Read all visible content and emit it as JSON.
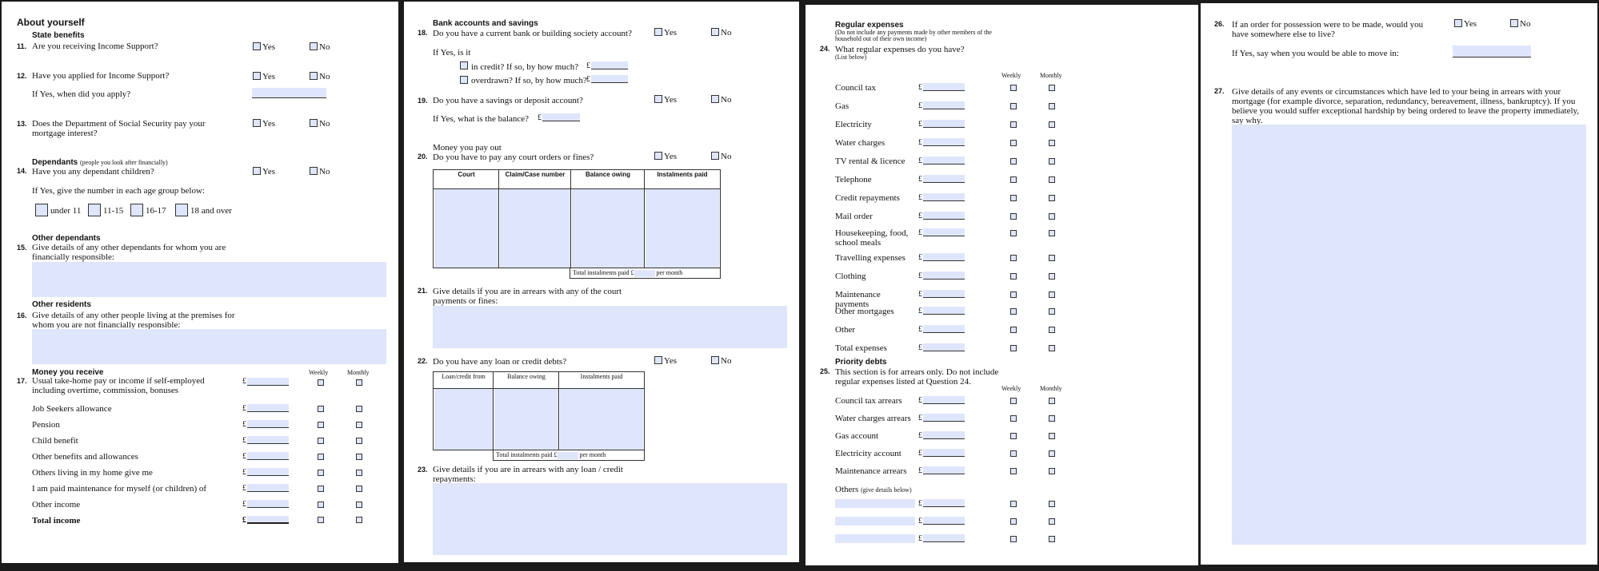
{
  "p1": {
    "section_title": "About yourself",
    "state_benefits": "State benefits",
    "q11": {
      "num": "11.",
      "text": "Are you receiving Income Support?"
    },
    "q12": {
      "num": "12.",
      "text": "Have you applied for Income Support?",
      "sub": "If Yes, when did you apply?"
    },
    "q13": {
      "num": "13.",
      "text": "Does the Department of Social Security pay your mortgage interest?"
    },
    "dependants": "Dependants",
    "dependants_note": "(people you look after financially)",
    "q14": {
      "num": "14.",
      "text": "Have you any dependant children?",
      "sub": "If Yes, give the number in each age group below:"
    },
    "age_groups": [
      "under 11",
      "11-15",
      "16-17",
      "18 and over"
    ],
    "other_dependants": "Other dependants",
    "q15": {
      "num": "15.",
      "text": "Give details of any other dependants for whom you are financially responsible:"
    },
    "other_residents": "Other residents",
    "q16": {
      "num": "16.",
      "text": "Give details of any other people living at the premises for whom you are not financially responsible:"
    },
    "money_receive": "Money you receive",
    "q17": {
      "num": "17.",
      "text": "Usual take-home pay or income if self-employed including overtime, commission, bonuses"
    },
    "income_rows": [
      "Job Seekers allowance",
      "Pension",
      "Child benefit",
      "Other benefits and allowances",
      "Others living in my home give me",
      "I am paid maintenance for myself (or children) of",
      "Other income"
    ],
    "total_income": "Total income"
  },
  "p2": {
    "bank_title": "Bank accounts and savings",
    "q18": {
      "num": "18.",
      "text": "Do you have a current bank or building society account?",
      "sub": "If Yes, is it",
      "credit": "in credit? If so, by how much?",
      "overdrawn": "overdrawn? If so, by how much?"
    },
    "q19": {
      "num": "19.",
      "text": "Do you have a savings or deposit account?",
      "sub": "If Yes, what is the balance?"
    },
    "money_out": "Money you pay out",
    "q20": {
      "num": "20.",
      "text": "Do you have to pay any court orders or fines?"
    },
    "court_table_headers": [
      "Court",
      "Claim/Case number",
      "Balance owing",
      "Instalments paid"
    ],
    "court_total": "Total instalments paid £",
    "per_month": "per month",
    "q21": {
      "num": "21.",
      "text": "Give details if you are in arrears with any of the court payments or fines:"
    },
    "q22": {
      "num": "22.",
      "text": "Do you have any loan or credit debts?"
    },
    "loan_table_headers": [
      "Loan/credit from",
      "Balance owing",
      "Instalments paid"
    ],
    "loan_total": "Total instalments paid £",
    "q23": {
      "num": "23.",
      "text": "Give details if you are in arrears with any loan / credit repayments:"
    }
  },
  "p3": {
    "regular_title": "Regular expenses",
    "regular_note": "(Do not include any payments made by other members of the household out of their own income)",
    "q24": {
      "num": "24.",
      "text": "What regular expenses do you have?",
      "note": "(List below)"
    },
    "expense_rows": [
      "Council tax",
      "Gas",
      "Electricity",
      "Water charges",
      "TV rental & licence",
      "Telephone",
      "Credit repayments",
      "Mail order",
      "Housekeeping, food, school meals",
      "Travelling expenses",
      "Clothing",
      "Maintenance payments",
      "Other mortgages",
      "Other",
      "Total expenses"
    ],
    "priority_title": "Priority debts",
    "q25": {
      "num": "25.",
      "text": "This section is for arrears only. Do not include regular expenses listed at Question 24."
    },
    "priority_rows": [
      "Council tax arrears",
      "Water charges arrears",
      "Gas account",
      "Electricity account",
      "Maintenance arrears"
    ],
    "others_label": "Others",
    "others_note": "(give details below)"
  },
  "p4": {
    "q26": {
      "num": "26.",
      "text": "If an order for possession were to be made, would you have somewhere else to live?",
      "sub": "If Yes, say when you would be able to move in:"
    },
    "q27": {
      "num": "27.",
      "text": "Give details of any events or circumstances which have led to your being in arrears with your mortgage (for example divorce, separation, redundancy, bereavement, illness, bankruptcy). If you believe you would suffer exceptional hardship by being ordered to leave the property immediately, say why."
    }
  },
  "common": {
    "yes": "Yes",
    "no": "No",
    "weekly": "Weekly",
    "monthly": "Monthly",
    "pound": "£"
  },
  "colors": {
    "field_fill": "#dfe5fb",
    "page_bg": "#ffffff",
    "backdrop": "#1b1b1b"
  }
}
